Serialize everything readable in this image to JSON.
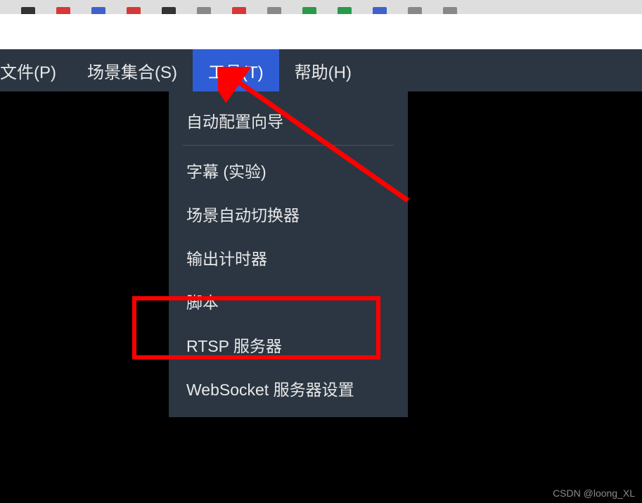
{
  "menubar": {
    "items": [
      {
        "label": "文件(P)"
      },
      {
        "label": "场景集合(S)"
      },
      {
        "label": "工具(T)",
        "active": true
      },
      {
        "label": "帮助(H)"
      }
    ]
  },
  "dropdown": {
    "items": [
      {
        "label": "自动配置向导",
        "type": "item"
      },
      {
        "type": "separator"
      },
      {
        "label": "字幕 (实验)",
        "type": "item"
      },
      {
        "label": "场景自动切换器",
        "type": "item"
      },
      {
        "label": "输出计时器",
        "type": "item"
      },
      {
        "label": "脚本",
        "type": "item"
      },
      {
        "label": "RTSP 服务器",
        "type": "item",
        "highlighted": true
      },
      {
        "label": "WebSocket 服务器设置",
        "type": "item"
      }
    ]
  },
  "annotations": {
    "highlight_color": "#ff0000",
    "arrow_color": "#ff0000"
  },
  "watermark": "CSDN @loong_XL"
}
